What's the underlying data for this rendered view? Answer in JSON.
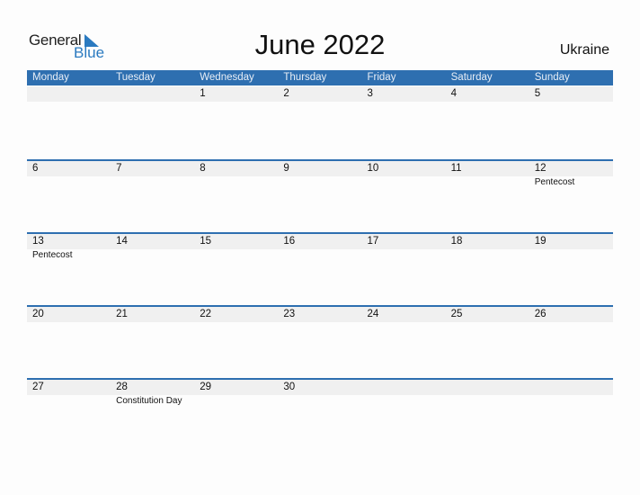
{
  "logo": {
    "word1": "General",
    "word2": "Blue"
  },
  "title": "June 2022",
  "country": "Ukraine",
  "weekdays": [
    "Monday",
    "Tuesday",
    "Wednesday",
    "Thursday",
    "Friday",
    "Saturday",
    "Sunday"
  ],
  "weeks": [
    {
      "days": [
        "",
        "",
        "1",
        "2",
        "3",
        "4",
        "5"
      ],
      "holidays": [
        "",
        "",
        "",
        "",
        "",
        "",
        ""
      ]
    },
    {
      "days": [
        "6",
        "7",
        "8",
        "9",
        "10",
        "11",
        "12"
      ],
      "holidays": [
        "",
        "",
        "",
        "",
        "",
        "",
        "Pentecost"
      ]
    },
    {
      "days": [
        "13",
        "14",
        "15",
        "16",
        "17",
        "18",
        "19"
      ],
      "holidays": [
        "Pentecost",
        "",
        "",
        "",
        "",
        "",
        ""
      ]
    },
    {
      "days": [
        "20",
        "21",
        "22",
        "23",
        "24",
        "25",
        "26"
      ],
      "holidays": [
        "",
        "",
        "",
        "",
        "",
        "",
        ""
      ]
    },
    {
      "days": [
        "27",
        "28",
        "29",
        "30",
        "",
        "",
        ""
      ],
      "holidays": [
        "",
        "Constitution Day",
        "",
        "",
        "",
        "",
        ""
      ]
    }
  ],
  "colors": {
    "accent": "#2e6fb0",
    "band": "#f0f0f0",
    "logo_blue": "#2a7ac0"
  }
}
